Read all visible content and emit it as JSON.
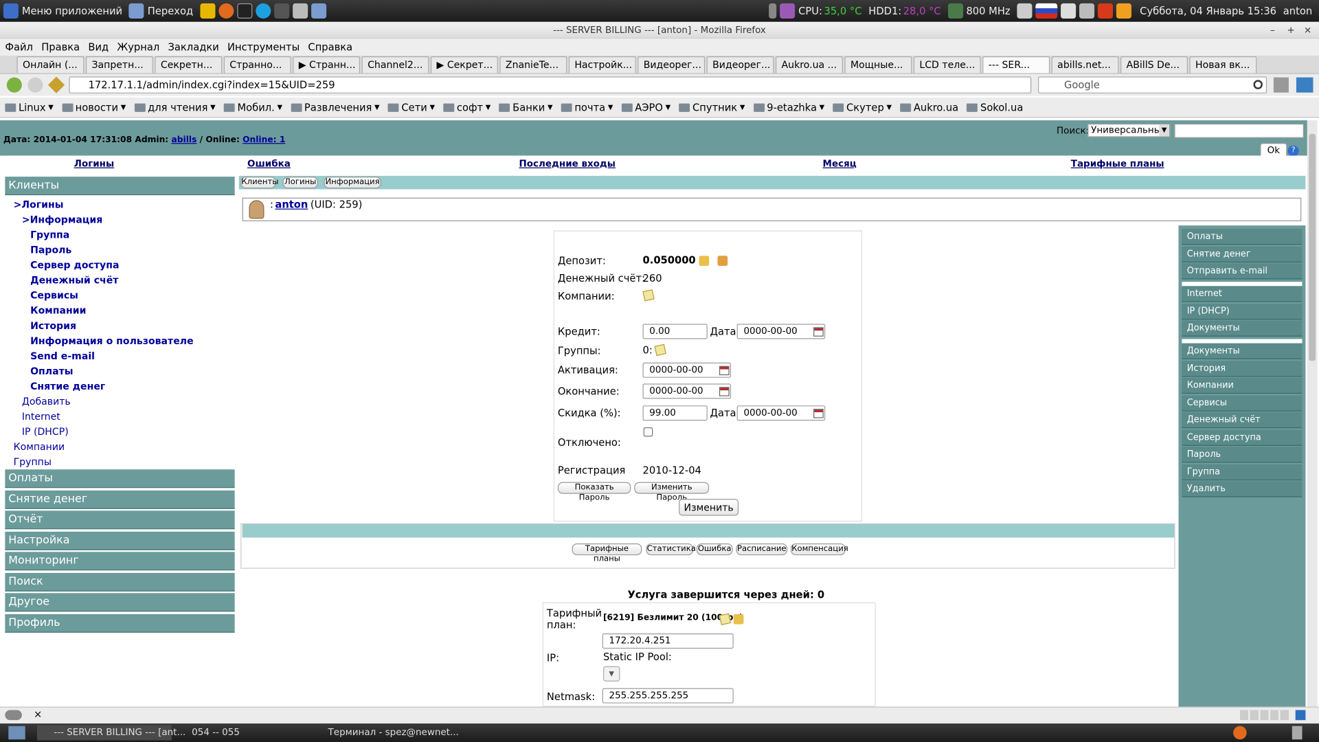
{
  "os": {
    "menu": "Меню приложений",
    "goto": "Переход",
    "cpu": "CPU:",
    "cpu_temp": "35,0 °C",
    "hdd": "HDD1:",
    "hdd_temp": "28,0 °C",
    "freq": "800 MHz",
    "datetime": "Суббота, 04 Январь 15:36",
    "user": "anton"
  },
  "window": {
    "title": "--- SERVER BILLING --- [anton] - Mozilla Firefox"
  },
  "menubar": [
    "Файл",
    "Правка",
    "Вид",
    "Журнал",
    "Закладки",
    "Инструменты",
    "Справка"
  ],
  "tabs": [
    "Онлайн (...",
    "Запретн...",
    "Секретн...",
    "Странно...",
    "▶ Странн...",
    "Channel2...",
    "▶ Секрет...",
    "ZnanieTe...",
    "Настройк...",
    "Видеорег...",
    "Видеорег...",
    "Aukro.ua ...",
    "Мощные...",
    "LCD теле...",
    "--- SER...",
    "abills.net...",
    "ABillS De...",
    "Новая вк..."
  ],
  "active_tab": 14,
  "url": "172.17.1.1/admin/index.cgi?index=15&UID=259",
  "search_engine": "Google",
  "bookmarks": [
    "Linux",
    "новости",
    "для чтения",
    "Мобил.",
    "Развлечения",
    "Сети",
    "софт",
    "Банки",
    "почта",
    "АЭРО",
    "Спутник",
    "9-etazhka",
    "Скутер",
    "Aukro.ua",
    "Sokol.ua"
  ],
  "header": {
    "date_label": "Дата:",
    "date": "2014-01-04 17:31:08",
    "admin_label": "Admin:",
    "admin": "abills",
    "online_label": "/ Online:",
    "online": "Online: 1",
    "search_label": "Поиск:",
    "search_select": "Универсальный",
    "ok": "Ok"
  },
  "topnav": [
    "Логины",
    "Ошибка",
    "Последние входы",
    "Месяц",
    "Тарифные планы"
  ],
  "sidebar": {
    "clients": "Клиенты",
    "logins": ">Логины",
    "info": ">Информация",
    "info_items": [
      "Группа",
      "Пароль",
      "Сервер доступа",
      "Денежный счёт",
      "Сервисы",
      "Компании",
      "История",
      "Информация о пользователе",
      "Send e-mail",
      "Оплаты",
      "Снятие денег"
    ],
    "sub_items": [
      "Добавить",
      "Internet",
      "IP (DHCP)"
    ],
    "items2": [
      "Компании",
      "Группы"
    ],
    "cats": [
      "Оплаты",
      "Снятие денег",
      "Отчёт",
      "Настройка",
      "Мониторинг",
      "Поиск",
      "Другое",
      "Профиль"
    ]
  },
  "breadcrumbs": [
    "Клиенты",
    "Логины",
    "Информация"
  ],
  "user": {
    "prefix": ":",
    "name": "anton",
    "uid": "(UID: 259)"
  },
  "form": {
    "deposit_label": "Депозит:",
    "deposit": "0.050000",
    "account_label": "Денежный счёт:",
    "account": "260",
    "company_label": "Компании:",
    "credit_label": "Кредит:",
    "credit": "0.00",
    "date_label": "Дата:",
    "credit_date": "0000-00-00",
    "groups_label": "Группы:",
    "groups": "0:",
    "activation_label": "Активация:",
    "activation": "0000-00-00",
    "expire_label": "Окончание:",
    "expire": "0000-00-00",
    "discount_label": "Скидка (%):",
    "discount": "99.00",
    "discount_date": "0000-00-00",
    "disabled_label": "Отключено:",
    "reg_label": "Регистрация",
    "reg": "2010-12-04",
    "show_pass": "Показать Пароль",
    "change_pass": "Изменить Пароль",
    "submit": "Изменить"
  },
  "service_buttons": [
    "Тарифные планы",
    "Статистика",
    "Ошибка",
    "Расписание",
    "Компенсация"
  ],
  "service": {
    "days_text": "Услуга завершится через дней: 0",
    "tariff_label": "Тарифный план:",
    "tariff": "[6219] Безлимит 20 (100грн)",
    "ip_label": "IP:",
    "ip": "172.20.4.251",
    "pool_label": "Static IP Pool:",
    "netmask_label": "Netmask:",
    "netmask": "255.255.255.255"
  },
  "rightbar": {
    "group1": [
      "Оплаты",
      "Снятие денег",
      "Отправить e-mail"
    ],
    "group2": [
      "Internet",
      "IP (DHCP)",
      "Документы"
    ],
    "group3": [
      "Документы",
      "История",
      "Компании",
      "Сервисы",
      "Денежный счёт",
      "Сервер доступа",
      "Пароль",
      "Группа",
      "Удалить"
    ]
  },
  "taskbar": [
    "--- SERVER BILLING --- [ant...",
    "054 -- 055",
    "Терминал - spez@newnet..."
  ]
}
